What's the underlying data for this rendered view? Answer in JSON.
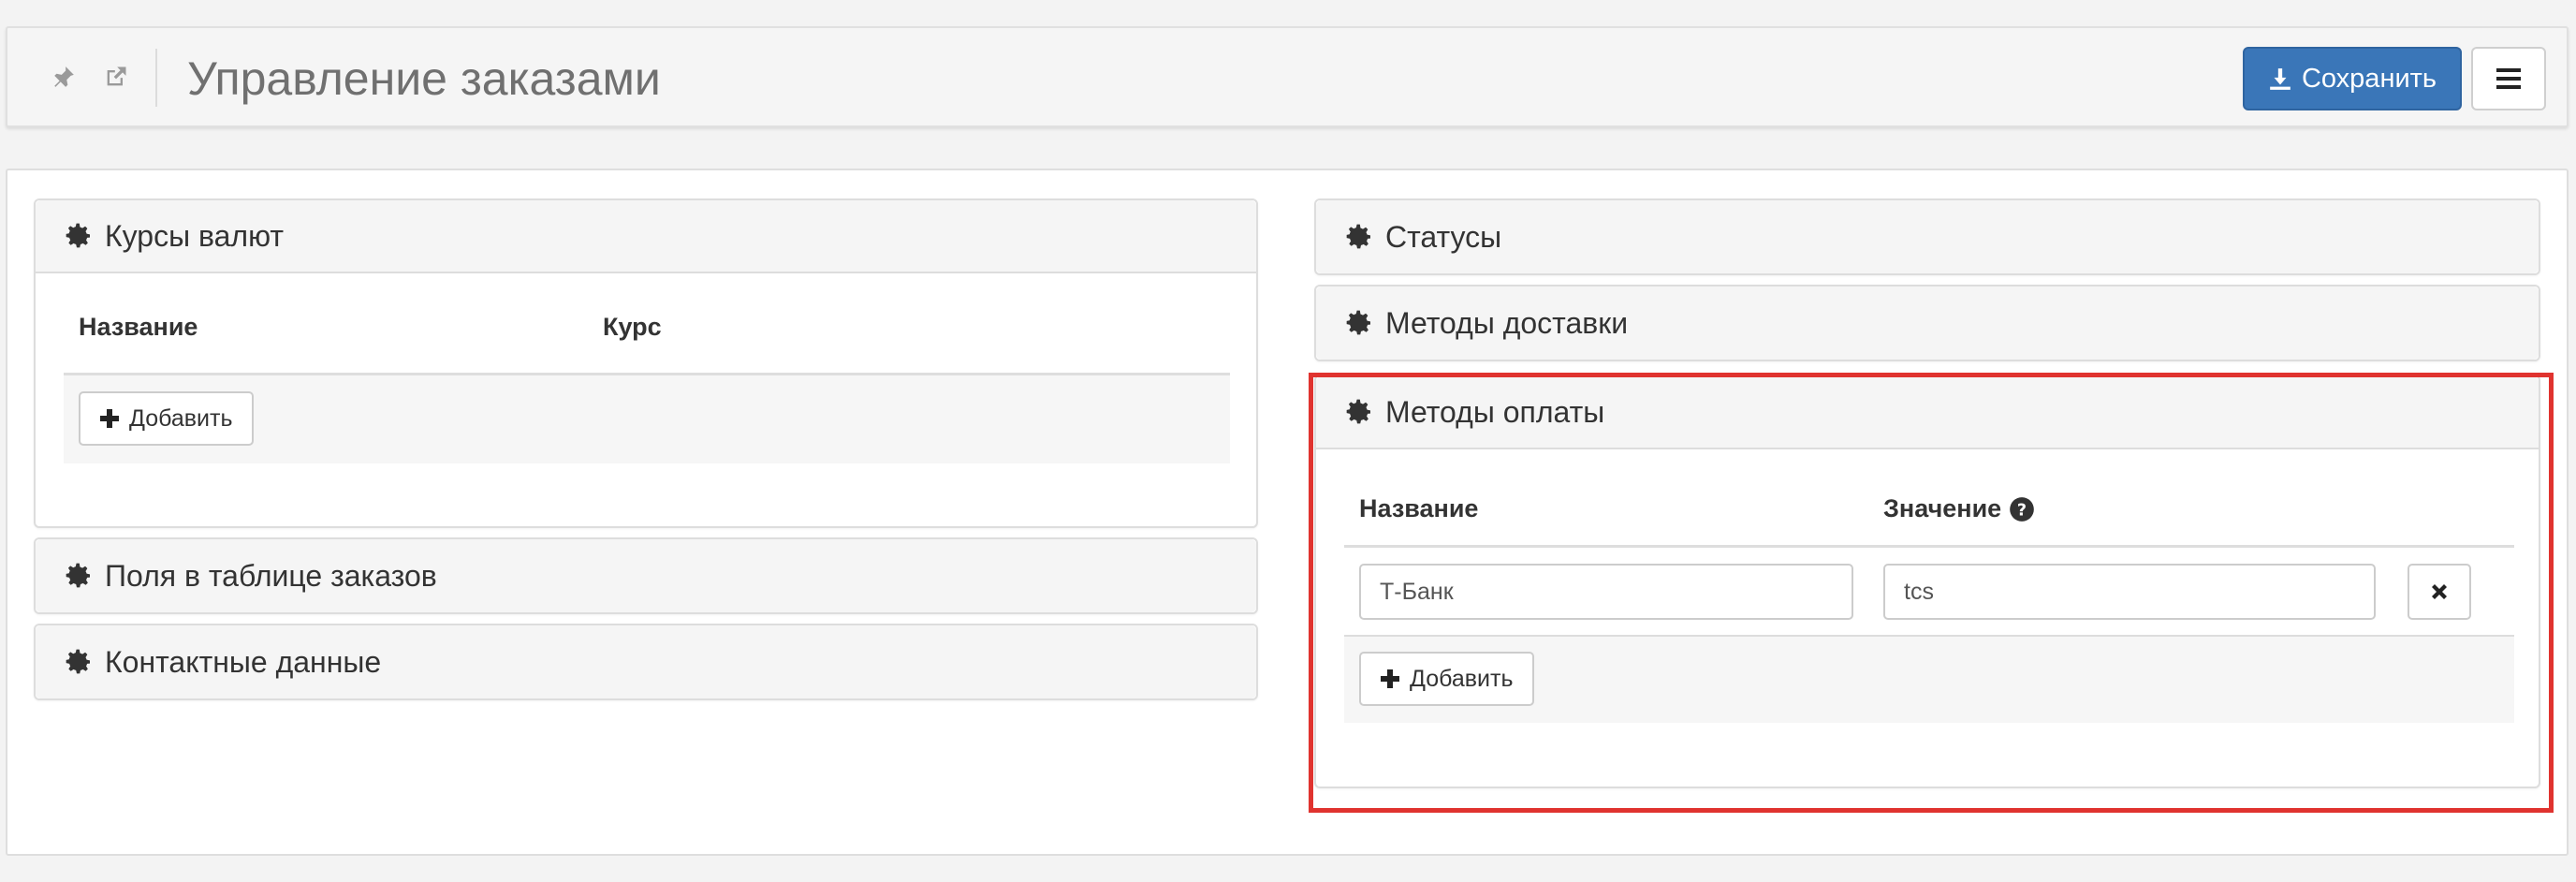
{
  "header": {
    "title": "Управление заказами",
    "save_label": "Сохранить",
    "icons": [
      "pin-icon",
      "external-link-icon",
      "download-icon",
      "menu-icon"
    ]
  },
  "left": {
    "currency": {
      "title": "Курсы валют",
      "columns": [
        "Название",
        "Курс"
      ],
      "add_label": "Добавить"
    },
    "order_fields": {
      "title": "Поля в таблице заказов"
    },
    "contacts": {
      "title": "Контактные данные"
    }
  },
  "right": {
    "statuses": {
      "title": "Статусы"
    },
    "delivery": {
      "title": "Методы доставки"
    },
    "payment": {
      "title": "Методы оплаты",
      "columns": [
        "Название",
        "Значение"
      ],
      "rows": [
        {
          "name": "Т-Банк",
          "value": "tcs"
        }
      ],
      "add_label": "Добавить"
    }
  },
  "colors": {
    "primary": "#3a76b8",
    "highlight": "#e0332f",
    "panel_bg": "#f5f5f5"
  }
}
